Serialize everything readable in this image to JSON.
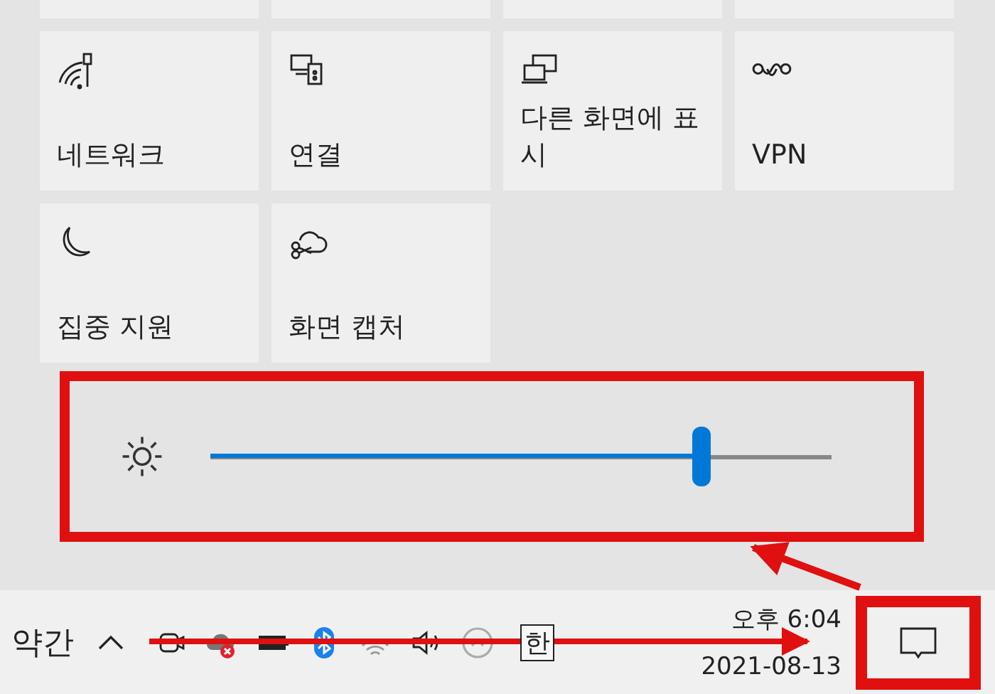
{
  "quick_actions": [
    {
      "label": "네트워크"
    },
    {
      "label": "연결"
    },
    {
      "label": "다른 화면에 표시"
    },
    {
      "label": "VPN"
    },
    {
      "label": "집중 지원"
    },
    {
      "label": "화면 캡처"
    }
  ],
  "brightness": {
    "level": 0.79
  },
  "taskbar": {
    "text": "약간",
    "ime": "한",
    "time": "오후 6:04",
    "date": "2021-08-13"
  }
}
